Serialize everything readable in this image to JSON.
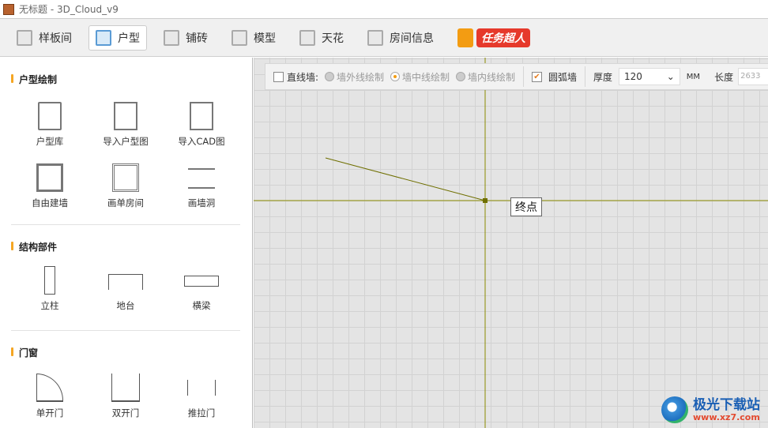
{
  "window": {
    "title": "无标题 - 3D_Cloud_v9"
  },
  "toolbar": {
    "items": [
      {
        "label": "样板间",
        "icon": "house-sparkle-icon"
      },
      {
        "label": "户型",
        "icon": "floorplan-pencil-icon",
        "active": true
      },
      {
        "label": "铺砖",
        "icon": "tiles-icon"
      },
      {
        "label": "模型",
        "icon": "sofa-icon"
      },
      {
        "label": "天花",
        "icon": "ceiling-icon"
      },
      {
        "label": "房间信息",
        "icon": "house-icon"
      }
    ],
    "promo": "任务超人"
  },
  "left_panel": {
    "sections": [
      {
        "title": "户型绘制",
        "items": [
          "户型库",
          "导入户型图",
          "导入CAD图",
          "自由建墙",
          "画单房间",
          "画墙洞"
        ]
      },
      {
        "title": "结构部件",
        "items": [
          "立柱",
          "地台",
          "横梁"
        ]
      },
      {
        "title": "门窗",
        "items": [
          "单开门",
          "双开门",
          "推拉门"
        ]
      }
    ]
  },
  "options": {
    "straight_wall": {
      "label": "直线墙:",
      "checked": false
    },
    "radios": [
      {
        "label": "墙外线绘制",
        "selected": false
      },
      {
        "label": "墙中线绘制",
        "selected": true
      },
      {
        "label": "墙内线绘制",
        "selected": false
      }
    ],
    "arc_wall": {
      "label": "圆弧墙",
      "checked": true
    },
    "thickness_label": "厚度",
    "thickness_value": "120",
    "unit": "MM",
    "length_label": "长度",
    "length_value": "2633"
  },
  "canvas": {
    "tooltip": "终点",
    "line_color": "#8a8a00"
  },
  "watermark": {
    "name": "极光下载站",
    "url": "www.xz7.com"
  }
}
